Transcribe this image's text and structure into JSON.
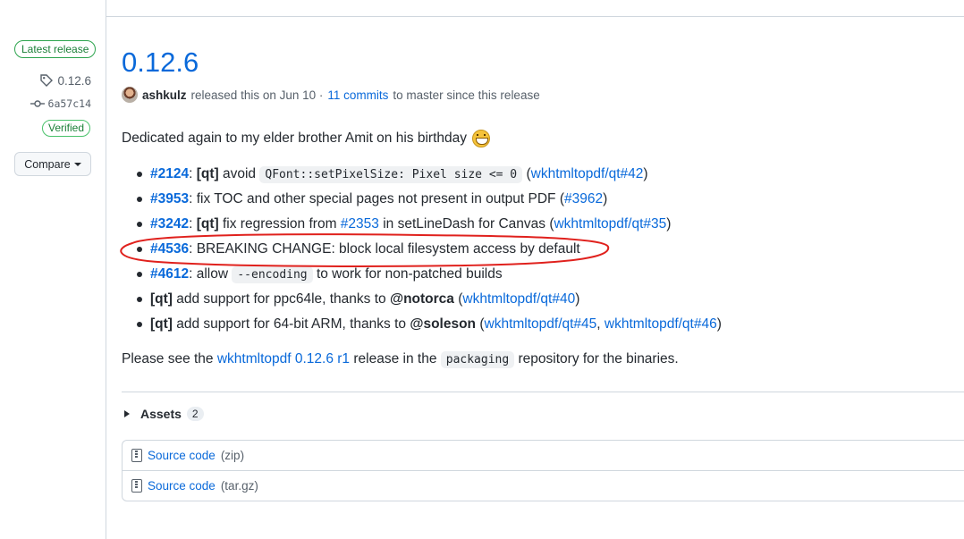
{
  "sidebar": {
    "latest_label": "Latest release",
    "tag": "0.12.6",
    "commit": "6a57c14",
    "verified": "Verified",
    "compare_label": "Compare"
  },
  "release": {
    "title": "0.12.6",
    "author": "ashkulz",
    "released_text": "released this on Jun 10 ·",
    "commits_link": "11 commits",
    "since_text": "to master since this release",
    "dedication": "Dedicated again to my elder brother Amit on his birthday",
    "changes": {
      "c1": {
        "issue": "#2124",
        "colon": ":",
        "tag": "[qt]",
        "text": "avoid",
        "code": "QFont::setPixelSize: Pixel size <= 0",
        "open": "(",
        "link": "wkhtmltopdf/qt#42",
        "close": ")"
      },
      "c2": {
        "issue": "#3953",
        "text": ": fix TOC and other special pages not present in output PDF (",
        "link": "#3962",
        "close": ")"
      },
      "c3": {
        "issue": "#3242",
        "colon": ":",
        "tag": "[qt]",
        "text": "fix regression from",
        "link1": "#2353",
        "text2": "in setLineDash for Canvas (",
        "link2": "wkhtmltopdf/qt#35",
        "close": ")"
      },
      "c4": {
        "issue": "#4536",
        "text": ": BREAKING CHANGE: block local filesystem access by default"
      },
      "c5": {
        "issue": "#4612",
        "text": ": allow",
        "code": "--encoding",
        "text2": "to work for non-patched builds"
      },
      "c6": {
        "tag": "[qt]",
        "text": "add support for ppc64le, thanks to",
        "user": "@notorca",
        "open": "(",
        "link": "wkhtmltopdf/qt#40",
        "close": ")"
      },
      "c7": {
        "tag": "[qt]",
        "text": "add support for 64-bit ARM, thanks to",
        "user": "@soleson",
        "open": "(",
        "link1": "wkhtmltopdf/qt#45",
        "sep": ",",
        "link2": "wkhtmltopdf/qt#46",
        "close": ")"
      }
    },
    "please": {
      "pre": "Please see the",
      "link": "wkhtmltopdf 0.12.6 r1",
      "mid": "release in the",
      "code": "packaging",
      "post": "repository for the binaries."
    }
  },
  "assets": {
    "label": "Assets",
    "count": "2",
    "items": [
      {
        "name": "Source code",
        "ext": "(zip)"
      },
      {
        "name": "Source code",
        "ext": "(tar.gz)"
      }
    ]
  },
  "annotation": {
    "color": "#e0211d"
  },
  "colors": {
    "link": "#0969da",
    "verified": "#1a7f37",
    "border": "#d0d7de"
  }
}
